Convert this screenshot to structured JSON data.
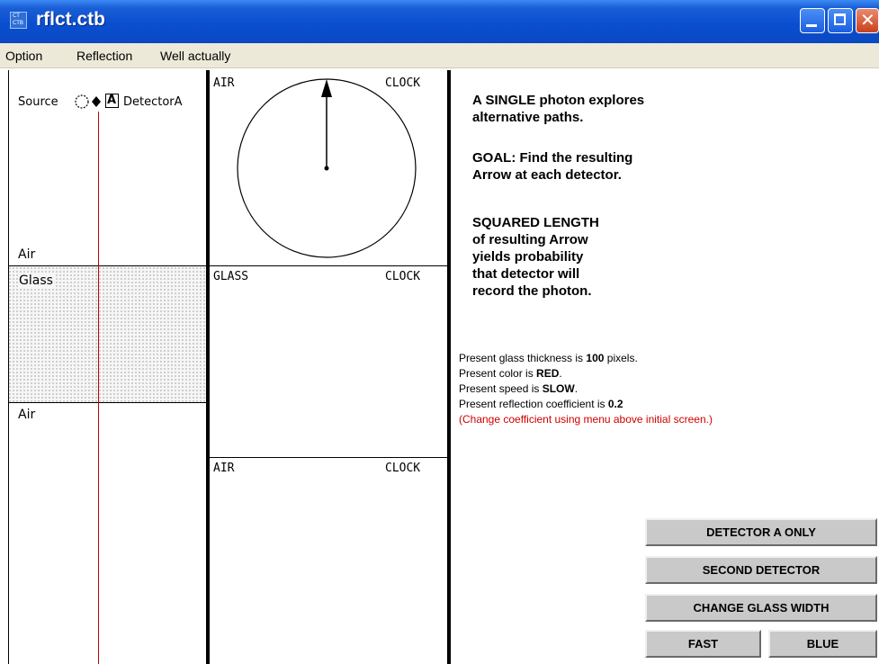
{
  "window": {
    "title": "rflct.ctb",
    "icon": "ctb-app-icon",
    "controls": [
      "minimize-icon",
      "maximize-icon",
      "close-icon"
    ]
  },
  "menu": [
    "Option",
    "Reflection",
    "Well actually"
  ],
  "left_panel": {
    "source_label": "Source",
    "detector_box": "A",
    "detector_label": "DetectorA",
    "air_top": "Air",
    "glass": "Glass",
    "air_bottom": "Air"
  },
  "clock_panels": [
    {
      "region": "AIR",
      "clock": "CLOCK"
    },
    {
      "region": "GLASS",
      "clock": "CLOCK"
    },
    {
      "region": "AIR",
      "clock": "CLOCK"
    }
  ],
  "info": {
    "p1": [
      "A SINGLE photon explores",
      "alternative paths."
    ],
    "p2": [
      "GOAL:  Find the resulting",
      "Arrow at each detector."
    ],
    "p3": [
      "SQUARED LENGTH",
      "of resulting Arrow",
      "yields probability",
      "that detector will",
      "record the photon."
    ]
  },
  "status": {
    "thickness_prefix": "Present glass thickness is ",
    "thickness_value": "100",
    "thickness_suffix": " pixels.",
    "color_prefix": "Present color is ",
    "color_value": "RED",
    "color_suffix": ".",
    "speed_prefix": "Present speed is ",
    "speed_value": "SLOW",
    "speed_suffix": ".",
    "coef_prefix": "Present reflection coefficient is ",
    "coef_value": "0.2",
    "note": "(Change coefficient using menu above initial screen.)"
  },
  "buttons": {
    "detector_a_only": "DETECTOR A ONLY",
    "second_detector": "SECOND DETECTOR",
    "change_glass_width": "CHANGE GLASS WIDTH",
    "fast": "FAST",
    "blue": "BLUE"
  },
  "colors": {
    "titlebar": "#0a4ed0",
    "menubar": "#ece9d8",
    "photon_path": "#c00000",
    "note_text": "#d00000",
    "button_face": "#c9c9c9"
  }
}
